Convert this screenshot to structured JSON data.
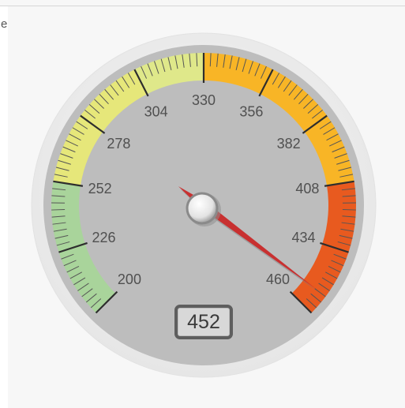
{
  "panel": {
    "title_fragment": "e"
  },
  "gauge": {
    "min": 200,
    "max": 460,
    "value": 452,
    "display_value": "452",
    "labels": [
      "200",
      "226",
      "252",
      "278",
      "304",
      "330",
      "356",
      "382",
      "408",
      "434",
      "460"
    ],
    "bands": [
      {
        "from": 200,
        "to": 252,
        "color": "#a9d49b"
      },
      {
        "from": 252,
        "to": 304,
        "color": "#e6e77a"
      },
      {
        "from": 304,
        "to": 330,
        "color": "#dfe88a"
      },
      {
        "from": 330,
        "to": 408,
        "color": "#f8b526"
      },
      {
        "from": 408,
        "to": 460,
        "color": "#e85a1f"
      }
    ],
    "colors": {
      "face": "#bdbdbd",
      "rim": "#f3f3f3",
      "needle": "#c83030"
    }
  }
}
